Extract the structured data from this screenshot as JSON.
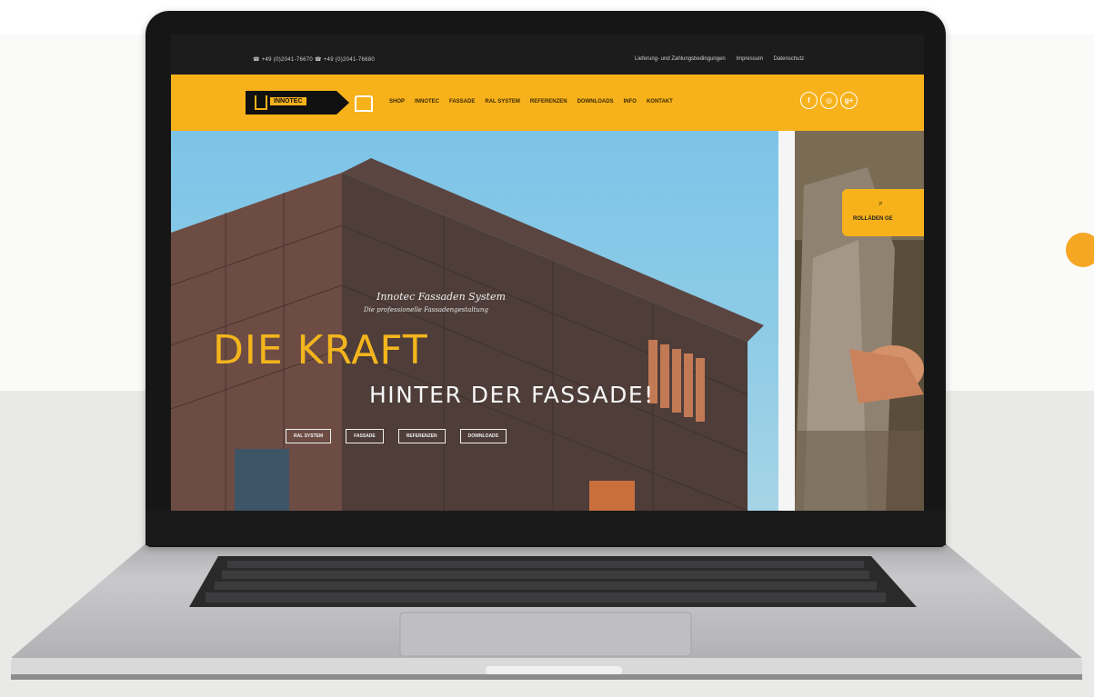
{
  "topbar": {
    "phones": "☎ +49 (0)2041-76670  ☎ +49 (0)2041-76680",
    "links": [
      "Lieferung- und Zahlungsbedingungen",
      "Impressum",
      "Datenschutz"
    ]
  },
  "nav": {
    "logo_text": "INNOTEC",
    "menu": [
      "SHOP",
      "INNOTEC",
      "FASSADE",
      "RAL SYSTEM",
      "REFERENZEN",
      "DOWNLOADS",
      "INFO",
      "KONTAKT"
    ],
    "social_icons": [
      "facebook-icon",
      "instagram-icon",
      "googleplus-icon"
    ],
    "social_glyphs": [
      "f",
      "◎",
      "g+"
    ]
  },
  "hero": {
    "script_title": "Innotec Fassaden System",
    "script_sub": "Die professionelle Fassadengestaltung",
    "headline": "DIE KRAFT",
    "subline": "HINTER DER FASSADE!",
    "buttons": [
      "RAL SYSTEM",
      "FASSADE",
      "REFERENZEN",
      "DOWNLOADS"
    ]
  },
  "side": {
    "icon": "search-icon",
    "glyph": "⌕",
    "label": "ROLLÄDEN GE"
  },
  "colors": {
    "accent": "#f7b21b",
    "headline": "#f3b51d",
    "sky": "#7dc4e8",
    "facade": "#4e3d39"
  }
}
